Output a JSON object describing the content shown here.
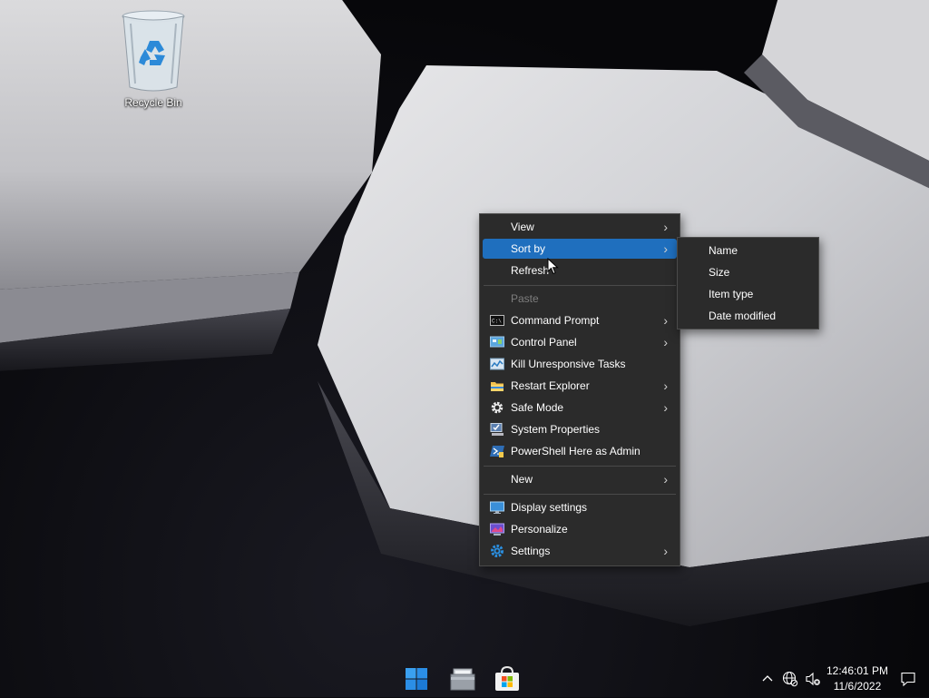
{
  "desktop": {
    "recycle_bin_label": "Recycle Bin"
  },
  "context_menu": {
    "items": [
      {
        "label": "View",
        "icon": "",
        "submenu": true
      },
      {
        "label": "Sort by",
        "icon": "",
        "submenu": true,
        "highlighted": true
      },
      {
        "label": "Refresh",
        "icon": ""
      },
      {
        "label": "Paste",
        "icon": "",
        "disabled": true
      },
      {
        "label": "Command Prompt",
        "icon": "cmd-icon",
        "submenu": true
      },
      {
        "label": "Control Panel",
        "icon": "control-panel-icon",
        "submenu": true
      },
      {
        "label": "Kill Unresponsive Tasks",
        "icon": "task-manager-icon"
      },
      {
        "label": "Restart Explorer",
        "icon": "folder-icon",
        "submenu": true
      },
      {
        "label": "Safe Mode",
        "icon": "gear-icon",
        "submenu": true
      },
      {
        "label": "System Properties",
        "icon": "system-properties-icon"
      },
      {
        "label": "PowerShell Here as Admin",
        "icon": "powershell-icon"
      },
      {
        "label": "New",
        "icon": "",
        "submenu": true
      },
      {
        "label": "Display settings",
        "icon": "display-icon"
      },
      {
        "label": "Personalize",
        "icon": "personalize-icon"
      },
      {
        "label": "Settings",
        "icon": "settings-gear-icon",
        "submenu": true
      }
    ]
  },
  "sort_submenu": {
    "items": [
      "Name",
      "Size",
      "Item type",
      "Date modified"
    ]
  },
  "taskbar": {
    "clock_time": "12:46:01 PM",
    "clock_date": "11/6/2022",
    "pinned": [
      "start-icon",
      "file-explorer-icon",
      "store-icon"
    ]
  },
  "colors": {
    "menu_bg": "#2b2b2b",
    "highlight": "#1f6fbe",
    "accent": "#0078d4"
  }
}
